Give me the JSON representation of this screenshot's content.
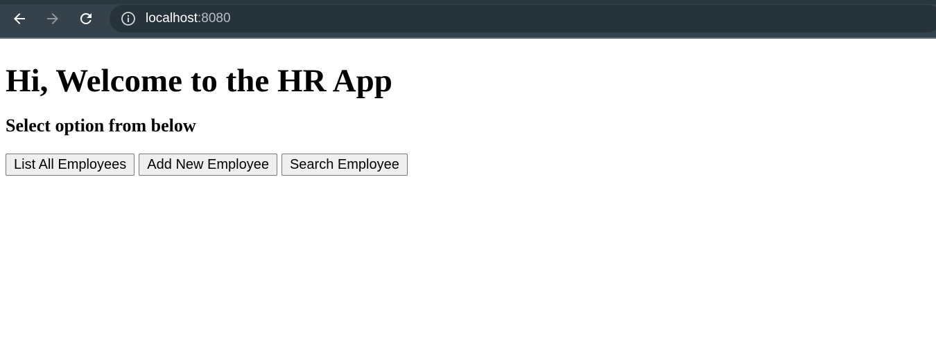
{
  "browser": {
    "url_host": "localhost",
    "url_port": ":8080",
    "toolbar_color": "#35424b",
    "omnibox_color": "#27333a"
  },
  "page": {
    "heading": "Hi, Welcome to the HR App",
    "subheading": "Select option from below",
    "buttons": {
      "list_all": "List All Employees",
      "add_new": "Add New Employee",
      "search": "Search Employee"
    }
  }
}
